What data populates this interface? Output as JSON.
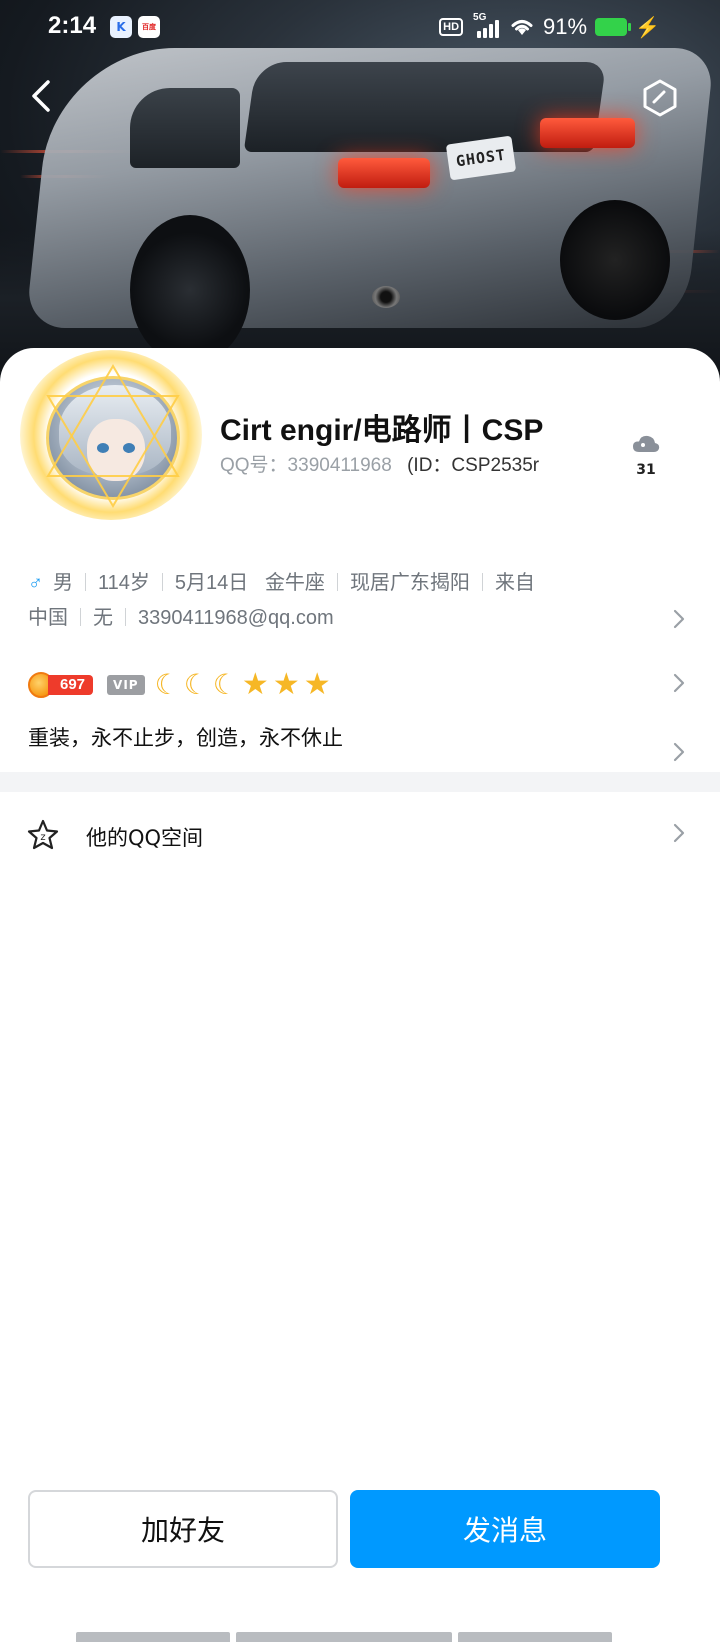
{
  "status_bar": {
    "time": "2:14",
    "network": "5G",
    "battery": "91%",
    "hd_label": "HD",
    "apps": [
      "K",
      "百度"
    ],
    "battery_level": 0.91,
    "battery_color": "#33d24a"
  },
  "header": {
    "back_icon": "chevron-left-icon",
    "settings_icon": "hexagon-settings-icon",
    "cover_plate": "GHOST"
  },
  "profile": {
    "name": "Cirt engir/电路师丨CSP",
    "qq_label": "QQ号：3390411968",
    "id_label": "(ID：CSP2535r",
    "weather_temp": "31",
    "weather_icon": "cloud-icon"
  },
  "info": {
    "gender": "男",
    "age": "114岁",
    "birthday": "5月14日",
    "zodiac": "金牛座",
    "location": "现居广东揭阳",
    "from": "来自",
    "country": "中国",
    "other": "无",
    "email": "3390411968@qq.com"
  },
  "badges": {
    "level": "697",
    "vip": "VIP",
    "moons": 3,
    "stars": 3,
    "accent_color": "#f6b726"
  },
  "signature": "重装，永不止步，创造，永不休止",
  "qzone": {
    "label": "他的QQ空间",
    "icon": "star-badge-icon"
  },
  "actions": {
    "add_friend": "加好友",
    "send_message": "发消息",
    "primary_color": "#0099ff"
  }
}
